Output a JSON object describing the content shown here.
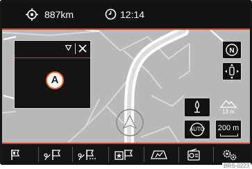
{
  "status": {
    "range_icon": "crosshair-icon",
    "range": "887km",
    "clock_icon": "clock-icon",
    "time": "12:14"
  },
  "popup": {
    "dropdown_icon": "triangle-down-icon",
    "close_icon": "close-icon",
    "marker_label": "A"
  },
  "map_controls": {
    "north_icon": "compass-north-icon",
    "position_icon": "vehicle-position-icon",
    "voice_icon": "voice-icon",
    "auto_label": "AUTO",
    "altitude_icon": "mountain-icon",
    "altitude": "13 m",
    "scale": "200 m"
  },
  "bottom_menu": [
    {
      "name": "destination-flag-icon"
    },
    {
      "name": "route-icon"
    },
    {
      "name": "route-options-icon"
    },
    {
      "name": "favorite-destination-icon"
    },
    {
      "name": "map-view-icon"
    },
    {
      "name": "traffic-radio-icon"
    },
    {
      "name": "settings-icon"
    }
  ],
  "ref_code": "BRS-0223"
}
